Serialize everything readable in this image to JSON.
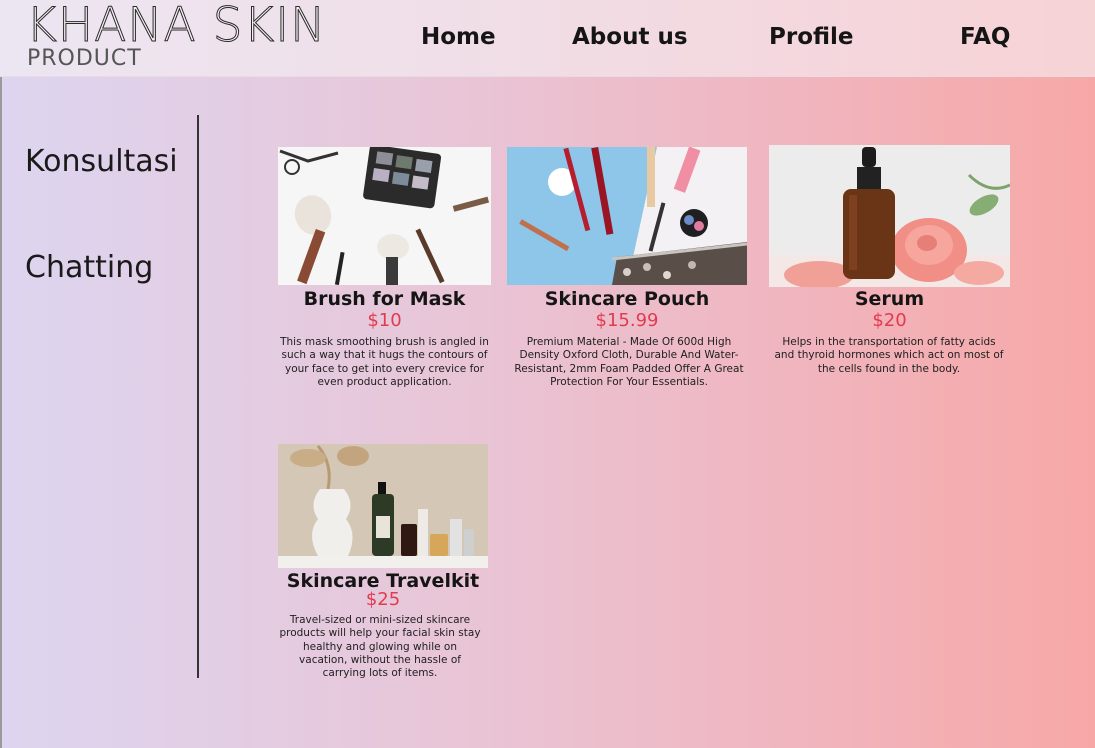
{
  "brand": {
    "title": "KHANA SKIN",
    "subtitle": "PRODUCT"
  },
  "nav": [
    {
      "label": "Home"
    },
    {
      "label": "About us"
    },
    {
      "label": "Profile"
    },
    {
      "label": "FAQ"
    }
  ],
  "sidebar": [
    {
      "label": "Konsultasi"
    },
    {
      "label": "Chatting"
    }
  ],
  "products": [
    {
      "name": "Brush for Mask",
      "price": "$10",
      "description": "This mask smoothing brush is angled in such a way that it hugs the contours of your face to get into every crevice for even product application."
    },
    {
      "name": "Skincare Pouch",
      "price": "$15.99",
      "description": "Premium Material - Made Of 600d High Density Oxford Cloth, Durable And Water-Resistant, 2mm Foam Padded Offer A Great Protection For Your Essentials."
    },
    {
      "name": "Serum",
      "price": "$20",
      "description": "Helps in the transportation of fatty acids and thyroid hormones which act on most of the cells found in the body."
    },
    {
      "name": "Skincare Travelkit",
      "price": "$25",
      "description": "Travel-sized or mini-sized skincare products will help your facial skin stay healthy and glowing while on vacation, without the hassle of carrying lots of items."
    }
  ],
  "colors": {
    "price": "#e33a4f",
    "background_start": "#ddd5f0",
    "background_end": "#f7a8a6"
  }
}
